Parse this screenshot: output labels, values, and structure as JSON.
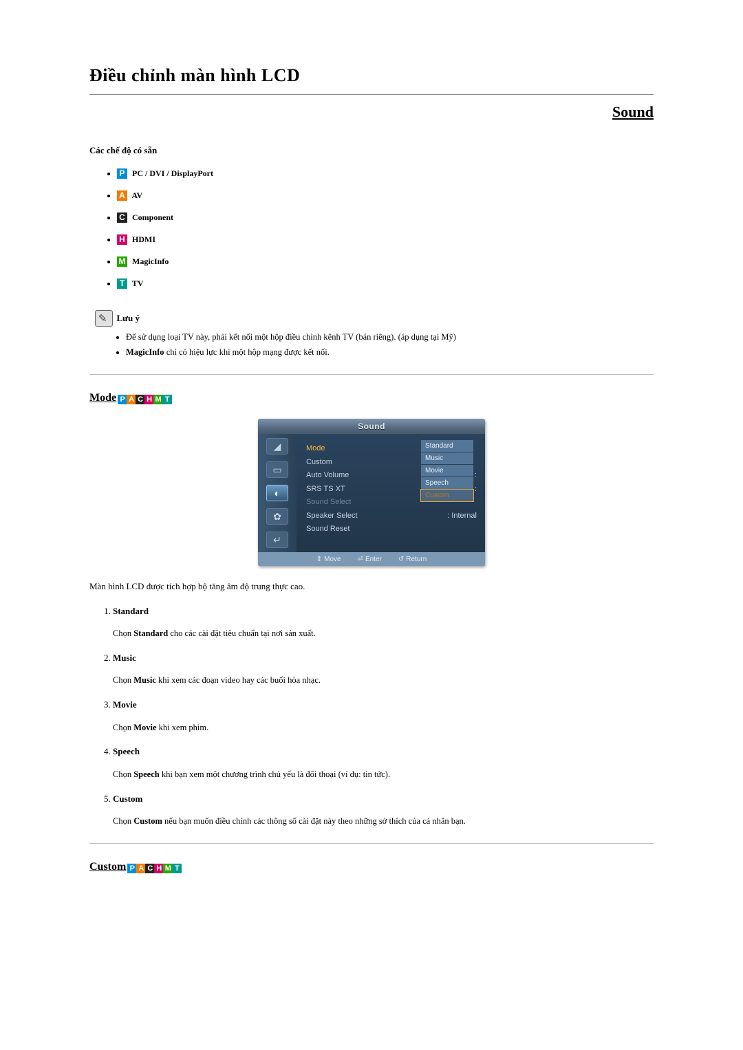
{
  "page_title": "Điều chỉnh màn hình LCD",
  "subtitle": "Sound",
  "modes_heading": "Các chế độ có sẵn",
  "mode_badges": {
    "p": "P",
    "a": "A",
    "c": "C",
    "h": "H",
    "m": "M",
    "t": "T"
  },
  "modes": {
    "pc": "PC / DVI / DisplayPort",
    "av": "AV",
    "component": "Component",
    "hdmi": "HDMI",
    "magicinfo": "MagicInfo",
    "tv": "TV"
  },
  "note": {
    "title": "Lưu ý",
    "items": [
      "Để sử dụng loại TV này, phải kết nối một hộp điều chỉnh kênh TV (bán riêng). (áp dụng tại Mỹ)",
      "<b>MagicInfo</b> chỉ có hiệu lực khi một hộp mạng được kết nối."
    ]
  },
  "mode_section_title": "Mode",
  "custom_section_title": "Custom",
  "osd": {
    "title": "Sound",
    "rows": {
      "mode": "Mode",
      "custom": "Custom",
      "autovol": "Auto Volume",
      "srs": "SRS TS XT",
      "ssel": "Sound Select",
      "spksel": "Speaker Select",
      "reset": "Sound Reset"
    },
    "values": {
      "mode": ": Standard",
      "spksel": ": Internal"
    },
    "submenu": [
      "Standard",
      "Music",
      "Movie",
      "Speech",
      "Custom"
    ],
    "footer": {
      "move": "Move",
      "enter": "Enter",
      "return": "Return"
    }
  },
  "intro_text": "Màn hình LCD được tích hợp bộ tăng âm độ trung thực cao.",
  "options": [
    {
      "title": "Standard",
      "desc": "Chọn <b>Standard</b> cho các cài đặt tiêu chuẩn tại nơi sản xuất."
    },
    {
      "title": "Music",
      "desc": "Chọn <b>Music</b> khi xem các đoạn video hay các buổi hòa nhạc."
    },
    {
      "title": "Movie",
      "desc": "Chọn <b>Movie</b> khi xem phim."
    },
    {
      "title": "Speech",
      "desc": "Chọn <b>Speech</b> khi bạn xem một chương trình chủ yếu là đối thoại (ví dụ: tin tức)."
    },
    {
      "title": "Custom",
      "desc": "Chọn <b>Custom</b> nếu bạn muốn điều chỉnh các thông số cài đặt này theo những sở thích của cá nhân bạn."
    }
  ]
}
